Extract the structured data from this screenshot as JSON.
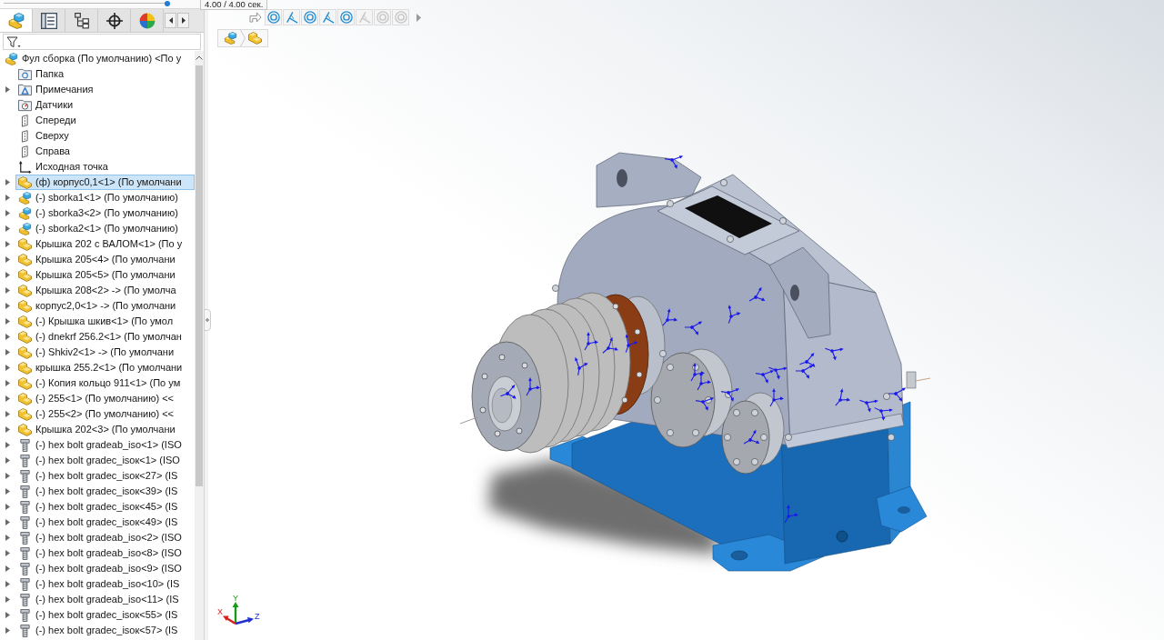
{
  "playback": {
    "level": 1,
    "time": "4.00 / 4.00 сек."
  },
  "panel_tabs": [
    {
      "kind": "feature-tree",
      "selected": true
    },
    {
      "kind": "property",
      "selected": false
    },
    {
      "kind": "configuration",
      "selected": false
    },
    {
      "kind": "dimxpert",
      "selected": false
    },
    {
      "kind": "display",
      "selected": false
    }
  ],
  "tree": {
    "label": "Фул сборка (По умолчанию) <По у",
    "kind": "assembly",
    "selected": false,
    "children": [
      {
        "label": "Папка",
        "kind": "folder",
        "expandable": false,
        "selected": false
      },
      {
        "label": "Примечания",
        "kind": "annotations",
        "expandable": true,
        "selected": false
      },
      {
        "label": "Датчики",
        "kind": "sensors",
        "expandable": false,
        "selected": false
      },
      {
        "label": "Спереди",
        "kind": "plane",
        "expandable": false,
        "selected": false
      },
      {
        "label": "Сверху",
        "kind": "plane",
        "expandable": false,
        "selected": false
      },
      {
        "label": "Справа",
        "kind": "plane",
        "expandable": false,
        "selected": false
      },
      {
        "label": "Исходная точка",
        "kind": "origin",
        "expandable": false,
        "selected": false
      },
      {
        "label": "(ф) корпус0,1<1> (По умолчани",
        "kind": "part",
        "expandable": true,
        "selected": true
      },
      {
        "label": "(-) sborka1<1> (По умолчанию)",
        "kind": "assembly",
        "expandable": true,
        "selected": false
      },
      {
        "label": "(-) sborka3<2> (По умолчанию)",
        "kind": "assembly",
        "expandable": true,
        "selected": false
      },
      {
        "label": "(-) sborka2<1> (По умолчанию)",
        "kind": "assembly",
        "expandable": true,
        "selected": false
      },
      {
        "label": "Крышка 202 с ВАЛОМ<1> (По у",
        "kind": "part",
        "expandable": true,
        "selected": false
      },
      {
        "label": "Крышка 205<4> (По умолчани",
        "kind": "part",
        "expandable": true,
        "selected": false
      },
      {
        "label": "Крышка 205<5> (По умолчани",
        "kind": "part",
        "expandable": true,
        "selected": false
      },
      {
        "label": "Крышка 208<2> -> (По умолча",
        "kind": "part",
        "expandable": true,
        "selected": false
      },
      {
        "label": "корпус2,0<1> -> (По умолчани",
        "kind": "part",
        "expandable": true,
        "selected": false
      },
      {
        "label": "(-) Крышка шкив<1> (По умол",
        "kind": "part",
        "expandable": true,
        "selected": false
      },
      {
        "label": "(-) dnekrf 256.2<1> (По умолчан",
        "kind": "part",
        "expandable": true,
        "selected": false
      },
      {
        "label": "(-) Shkiv2<1> -> (По умолчани",
        "kind": "part",
        "expandable": true,
        "selected": false
      },
      {
        "label": "крышка 255.2<1> (По умолчани",
        "kind": "part",
        "expandable": true,
        "selected": false
      },
      {
        "label": "(-) Копия кольцо 911<1> (По ум",
        "kind": "part",
        "expandable": true,
        "selected": false
      },
      {
        "label": "(-) 255<1> (По умолчанию) <<",
        "kind": "part",
        "expandable": true,
        "selected": false
      },
      {
        "label": "(-) 255<2> (По умолчанию) <<",
        "kind": "part",
        "expandable": true,
        "selected": false
      },
      {
        "label": "Крышка 202<3> (По умолчани",
        "kind": "part",
        "expandable": true,
        "selected": false
      },
      {
        "label": "(-) hex bolt gradeab_iso<1> (ISO",
        "kind": "bolt",
        "expandable": true,
        "selected": false
      },
      {
        "label": "(-) hex bolt gradec_isoк<1> (ISO",
        "kind": "bolt",
        "expandable": true,
        "selected": false
      },
      {
        "label": "(-) hex bolt gradec_isoк<27> (IS",
        "kind": "bolt",
        "expandable": true,
        "selected": false
      },
      {
        "label": "(-) hex bolt gradec_isoк<39> (IS",
        "kind": "bolt",
        "expandable": true,
        "selected": false
      },
      {
        "label": "(-) hex bolt gradec_isoк<45> (IS",
        "kind": "bolt",
        "expandable": true,
        "selected": false
      },
      {
        "label": "(-) hex bolt gradec_isoк<49> (IS",
        "kind": "bolt",
        "expandable": true,
        "selected": false
      },
      {
        "label": "(-) hex bolt gradeab_iso<2> (ISO",
        "kind": "bolt",
        "expandable": true,
        "selected": false
      },
      {
        "label": "(-) hex bolt gradeab_iso<8> (ISO",
        "kind": "bolt",
        "expandable": true,
        "selected": false
      },
      {
        "label": "(-) hex bolt gradeab_iso<9> (ISO",
        "kind": "bolt",
        "expandable": true,
        "selected": false
      },
      {
        "label": "(-) hex bolt gradeab_iso<10> (IS",
        "kind": "bolt",
        "expandable": true,
        "selected": false
      },
      {
        "label": "(-) hex bolt gradeab_iso<11> (IS",
        "kind": "bolt",
        "expandable": true,
        "selected": false
      },
      {
        "label": "(-) hex bolt gradec_isoк<55> (IS",
        "kind": "bolt",
        "expandable": true,
        "selected": false
      },
      {
        "label": "(-) hex bolt gradec_isoк<57> (IS",
        "kind": "bolt",
        "expandable": true,
        "selected": false
      }
    ]
  },
  "toolbar": [
    {
      "kind": "concentric",
      "disabled": false
    },
    {
      "kind": "angle",
      "disabled": false
    },
    {
      "kind": "concentric",
      "disabled": false
    },
    {
      "kind": "angle",
      "disabled": false
    },
    {
      "kind": "concentric",
      "disabled": false
    },
    {
      "kind": "angle",
      "disabled": true
    },
    {
      "kind": "concentric",
      "disabled": true
    },
    {
      "kind": "concentric",
      "disabled": true
    }
  ],
  "breadcrumb": [
    {
      "kind": "assembly"
    },
    {
      "kind": "part"
    }
  ],
  "triad": {
    "x": "X",
    "y": "Y",
    "z": "Z"
  }
}
